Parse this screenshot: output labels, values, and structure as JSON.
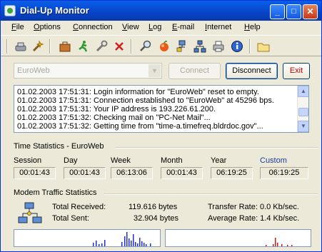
{
  "window": {
    "title": "Dial-Up Monitor",
    "controls": {
      "minimize": "_",
      "maximize": "□",
      "close": "✕"
    }
  },
  "menu": [
    {
      "label": "File",
      "key": "F",
      "rest": "ile"
    },
    {
      "label": "Options",
      "key": "O",
      "rest": "ptions"
    },
    {
      "label": "Connection",
      "key": "C",
      "rest": "onnection"
    },
    {
      "label": "View",
      "key": "V",
      "rest": "iew"
    },
    {
      "label": "Log",
      "key": "L",
      "rest": "og"
    },
    {
      "label": "E-mail",
      "key": "E",
      "rest": "-mail"
    },
    {
      "label": "Internet",
      "key": "I",
      "rest": "nternet"
    },
    {
      "label": "Help",
      "key": "H",
      "rest": "elp"
    }
  ],
  "toolbar_icons": [
    "connection-properties-icon",
    "wizard-icon",
    "briefcase-icon",
    "run-icon",
    "tools-icon",
    "delete-icon",
    "search-icon",
    "fireball-icon",
    "network-icon",
    "lan-icon",
    "printer-icon",
    "info-icon",
    "folder-icon"
  ],
  "connection": {
    "selected": "EuroWeb",
    "connect_label": "Connect",
    "disconnect_label": "Disconnect",
    "exit_label": "Exit"
  },
  "log_lines": [
    "01.02.2003 17:51:31: Login information for \"EuroWeb\" reset to empty.",
    "01.02.2003 17:51:31: Connection established to \"EuroWeb\" at 45296 bps.",
    "01.02.2003 17:51:31: Your IP address is 193.226.61.200.",
    "01.02.2003 17:51:32: Checking mail on \"PC-Net Mail\"...",
    "01.02.2003 17:51:32: Getting time from \"time-a.timefreq.bldrdoc.gov\"..."
  ],
  "time_stats": {
    "heading": "Time Statistics - EuroWeb",
    "columns": [
      {
        "label": "Session",
        "value": "00:01:43"
      },
      {
        "label": "Day",
        "value": "00:01:43"
      },
      {
        "label": "Week",
        "value": "06:13:06"
      },
      {
        "label": "Month",
        "value": "00:01:43"
      },
      {
        "label": "Year",
        "value": "06:19:25"
      },
      {
        "label": "Custom",
        "value": "06:19:25"
      }
    ]
  },
  "traffic": {
    "heading": "Modem Traffic Statistics",
    "received_label": "Total Received:",
    "received_value": "119.616 bytes",
    "sent_label": "Total Sent:",
    "sent_value": "32.904 bytes",
    "transfer_label": "Transfer Rate: 0.0 Kb/sec.",
    "average_label": "Average Rate: 1.4 Kb/sec.",
    "received_graph_color": "#1f2fd8",
    "sent_graph_color": "#d01818"
  }
}
